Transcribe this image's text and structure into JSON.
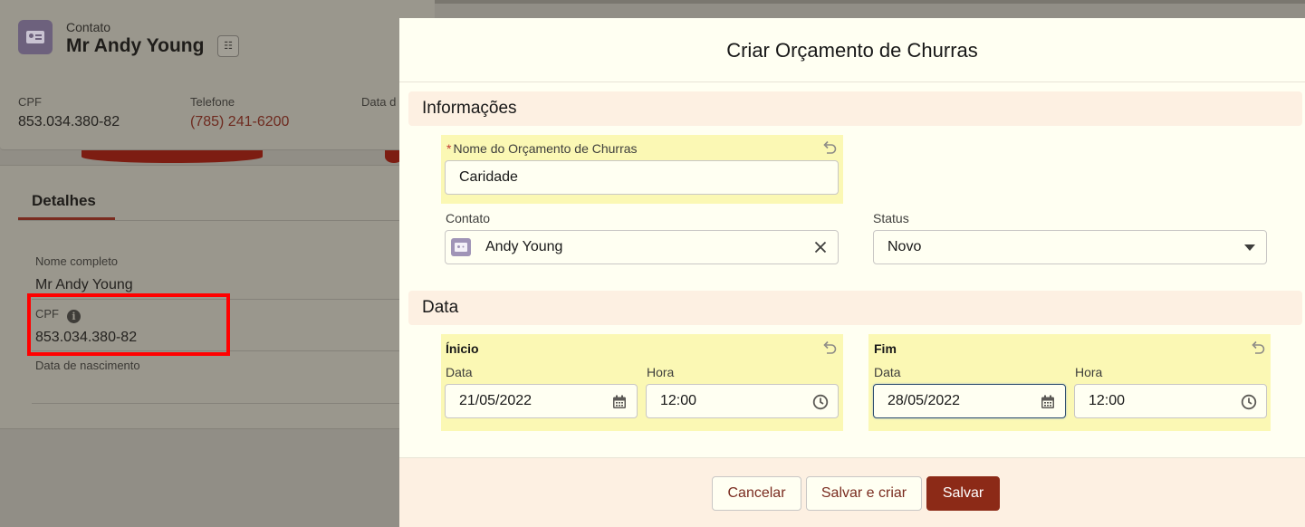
{
  "background": {
    "header": {
      "object_type": "Contato",
      "record_name": "Mr Andy Young",
      "fields": [
        {
          "label": "CPF",
          "value": "853.034.380-82"
        },
        {
          "label": "Telefone",
          "value": "(785) 241-6200"
        },
        {
          "label": "Data d",
          "value": ""
        }
      ]
    },
    "details": {
      "tab_label": "Detalhes",
      "full_name_label": "Nome completo",
      "full_name_value": "Mr Andy Young",
      "cpf_label": "CPF",
      "cpf_value": "853.034.380-82",
      "birth_label": "Data de nascimento",
      "birth_value": ""
    }
  },
  "modal": {
    "title": "Criar Orçamento de Churras",
    "sections": {
      "info": "Informações",
      "date": "Data"
    },
    "fields": {
      "name_label": "Nome do Orçamento de Churras",
      "name_required_mark": "*",
      "name_value": "Caridade",
      "contact_label": "Contato",
      "contact_value": "Andy Young",
      "status_label": "Status",
      "status_value": "Novo",
      "start_group": "Ínicio",
      "end_group": "Fim",
      "date_label": "Data",
      "time_label": "Hora",
      "start_date": "21/05/2022",
      "start_time": "12:00",
      "end_date": "28/05/2022",
      "end_time": "12:00"
    },
    "buttons": {
      "cancel": "Cancelar",
      "save_new": "Salvar e criar",
      "save": "Salvar"
    }
  },
  "colors": {
    "accent": "#8c2a17",
    "highlight": "#fbf8b4",
    "annotation_box": "#ff0000"
  },
  "icons": [
    "contact-icon",
    "hierarchy-icon",
    "info-icon",
    "undo-icon",
    "clear-icon",
    "chevron-down-icon",
    "calendar-icon",
    "clock-icon"
  ]
}
